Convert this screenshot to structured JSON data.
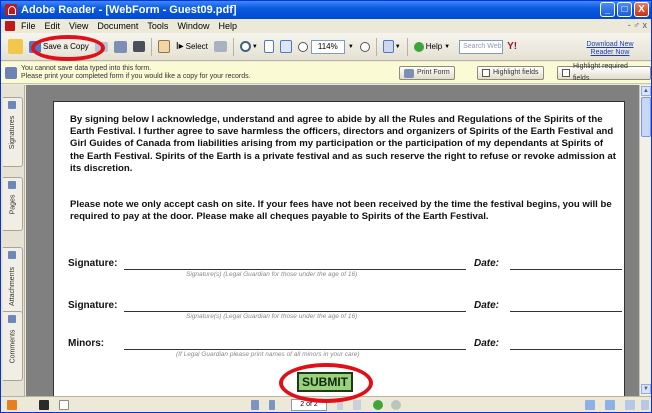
{
  "window": {
    "title": "Adobe Reader - [WebForm - Guest09.pdf]",
    "minimize": "_",
    "restore": "□",
    "close": "X"
  },
  "menu": {
    "items": [
      "File",
      "Edit",
      "View",
      "Document",
      "Tools",
      "Window",
      "Help"
    ],
    "right": "- ♂ x"
  },
  "toolbar": {
    "save_copy": "Save a Copy",
    "select": "Select",
    "zoom": "114%",
    "help": "Help",
    "search_placeholder": "Search Web",
    "download": "Download New Reader Now"
  },
  "message": {
    "line1": "You cannot save data typed into this form.",
    "line2": "Please print your completed form if you would like a copy for your records.",
    "print_form": "Print Form",
    "highlight_fields": "Highlight fields",
    "highlight_required": "Highlight required fields"
  },
  "side_tabs": [
    "Signatures",
    "Pages",
    "Attachments",
    "Comments"
  ],
  "document": {
    "para1": "By signing below I acknowledge, understand and agree to abide by all the Rules and Regulations of the Spirits of the Earth Festival. I further agree to save harmless the officers, directors and organizers of Spirits of the Earth Festival and Girl Guides of Canada from liabilities arising from my participation or the participation of my dependants at Spirits of the Earth Festival.  Spirits of the Earth is a private festival and as such reserve the right to refuse or revoke admission at its discretion.",
    "para2": "Please note we only accept cash on site.  If your fees have not been received by the time the festival begins, you will be required to pay at the door.  Please make all cheques payable to Spirits of the Earth Festival.",
    "signature_label": "Signature:",
    "date_label": "Date:",
    "minors_label": "Minors:",
    "signature_hint": "Signature(s) (Legal Guardian for those under the age of 16)",
    "minors_hint": "(If Legal Guardian please print names of all minors in your care)",
    "submit": "SUBMIT"
  },
  "status": {
    "page": "2 of 2"
  },
  "colors": {
    "highlight_ring": "#e0101a",
    "submit_fill": "#9bd07f"
  }
}
